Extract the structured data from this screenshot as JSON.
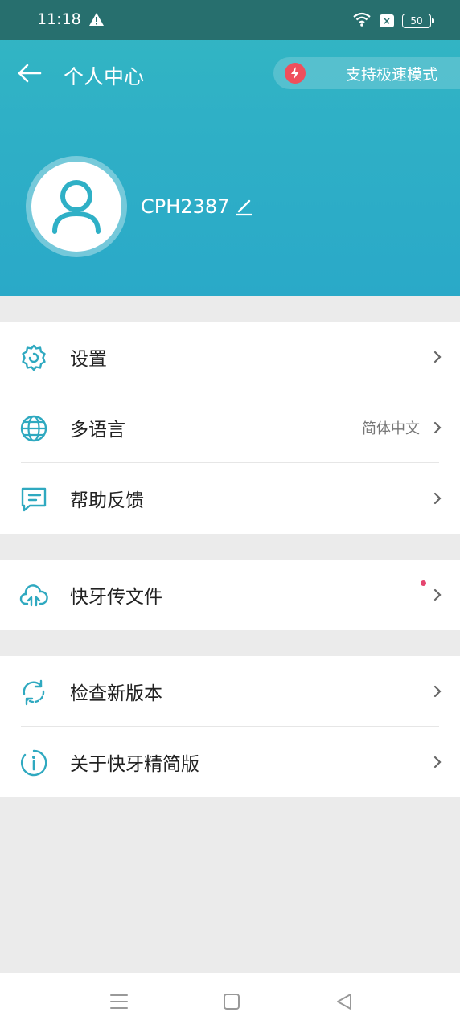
{
  "status_bar": {
    "time": "11:18",
    "battery": "50",
    "sim": "×"
  },
  "header": {
    "title": "个人中心",
    "speed_mode_label": "支持极速模式"
  },
  "profile": {
    "username": "CPH2387"
  },
  "menu": {
    "settings": {
      "label": "设置",
      "icon": "gear-icon"
    },
    "language": {
      "label": "多语言",
      "value": "简体中文",
      "icon": "globe-icon"
    },
    "feedback": {
      "label": "帮助反馈",
      "icon": "feedback-icon"
    },
    "transfer": {
      "label": "快牙传文件",
      "icon": "cloud-upload-icon"
    },
    "update": {
      "label": "检查新版本",
      "icon": "refresh-icon"
    },
    "about": {
      "label": "关于快牙精简版",
      "icon": "info-icon"
    }
  },
  "colors": {
    "accent": "#2fb0c6",
    "status_bar": "#276f6e",
    "icon": "#2fa9c0",
    "badge_red": "#e5456f",
    "speed_red": "#ef4f5c"
  }
}
